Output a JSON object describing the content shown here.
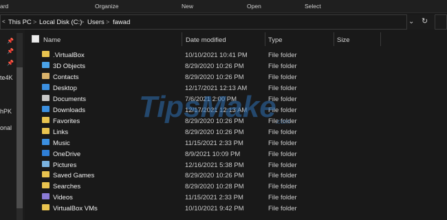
{
  "ribbon": {
    "items": [
      "ard",
      "Organize",
      "New",
      "Open",
      "Select"
    ]
  },
  "breadcrumb": {
    "segments": [
      "This PC",
      "Local Disk (C:)",
      "Users",
      "fawad"
    ],
    "separator": ">",
    "back_icon": "chevron-left-icon",
    "dropdown_icon": "chevron-down-icon",
    "refresh_icon": "refresh-icon"
  },
  "nav_pane": {
    "partial_labels": [
      "te4K",
      "hPK",
      "onal"
    ]
  },
  "columns": {
    "name": "Name",
    "date": "Date modified",
    "type": "Type",
    "size": "Size"
  },
  "files": [
    {
      "name": ".VirtualBox",
      "date": "10/10/2021 10:41 PM",
      "type": "File folder",
      "icon": "folder-icon",
      "color": "#e8c34f"
    },
    {
      "name": "3D Objects",
      "date": "8/29/2020 10:26 PM",
      "type": "File folder",
      "icon": "3d-objects-icon",
      "color": "#4aa3e8"
    },
    {
      "name": "Contacts",
      "date": "8/29/2020 10:26 PM",
      "type": "File folder",
      "icon": "contacts-icon",
      "color": "#d9b26a"
    },
    {
      "name": "Desktop",
      "date": "12/17/2021 12:13 AM",
      "type": "File folder",
      "icon": "desktop-icon",
      "color": "#3b8fe0"
    },
    {
      "name": "Documents",
      "date": "7/6/2021 2:00 PM",
      "type": "File folder",
      "icon": "documents-icon",
      "color": "#c8c8c8"
    },
    {
      "name": "Downloads",
      "date": "12/17/2021 12:13 AM",
      "type": "File folder",
      "icon": "downloads-icon",
      "color": "#3b8fe0"
    },
    {
      "name": "Favorites",
      "date": "8/29/2020 10:26 PM",
      "type": "File folder",
      "icon": "favorites-icon",
      "color": "#e8c34f"
    },
    {
      "name": "Links",
      "date": "8/29/2020 10:26 PM",
      "type": "File folder",
      "icon": "links-icon",
      "color": "#e8c34f"
    },
    {
      "name": "Music",
      "date": "11/15/2021 2:33 PM",
      "type": "File folder",
      "icon": "music-icon",
      "color": "#3b8fe0"
    },
    {
      "name": "OneDrive",
      "date": "8/9/2021 10:09 PM",
      "type": "File folder",
      "icon": "onedrive-icon",
      "color": "#2f7fd6"
    },
    {
      "name": "Pictures",
      "date": "12/16/2021 5:38 PM",
      "type": "File folder",
      "icon": "pictures-icon",
      "color": "#7ab3e0"
    },
    {
      "name": "Saved Games",
      "date": "8/29/2020 10:26 PM",
      "type": "File folder",
      "icon": "saved-games-icon",
      "color": "#e8c34f"
    },
    {
      "name": "Searches",
      "date": "8/29/2020 10:28 PM",
      "type": "File folder",
      "icon": "searches-icon",
      "color": "#e8c34f"
    },
    {
      "name": "Videos",
      "date": "11/15/2021 2:33 PM",
      "type": "File folder",
      "icon": "videos-icon",
      "color": "#8a7bd6"
    },
    {
      "name": "VirtualBox VMs",
      "date": "10/10/2021 9:42 PM",
      "type": "File folder",
      "icon": "folder-icon",
      "color": "#e8c34f"
    }
  ],
  "watermark": {
    "text": "TipsMake",
    "suffix": ".com",
    "color": "#2d6fb3"
  }
}
